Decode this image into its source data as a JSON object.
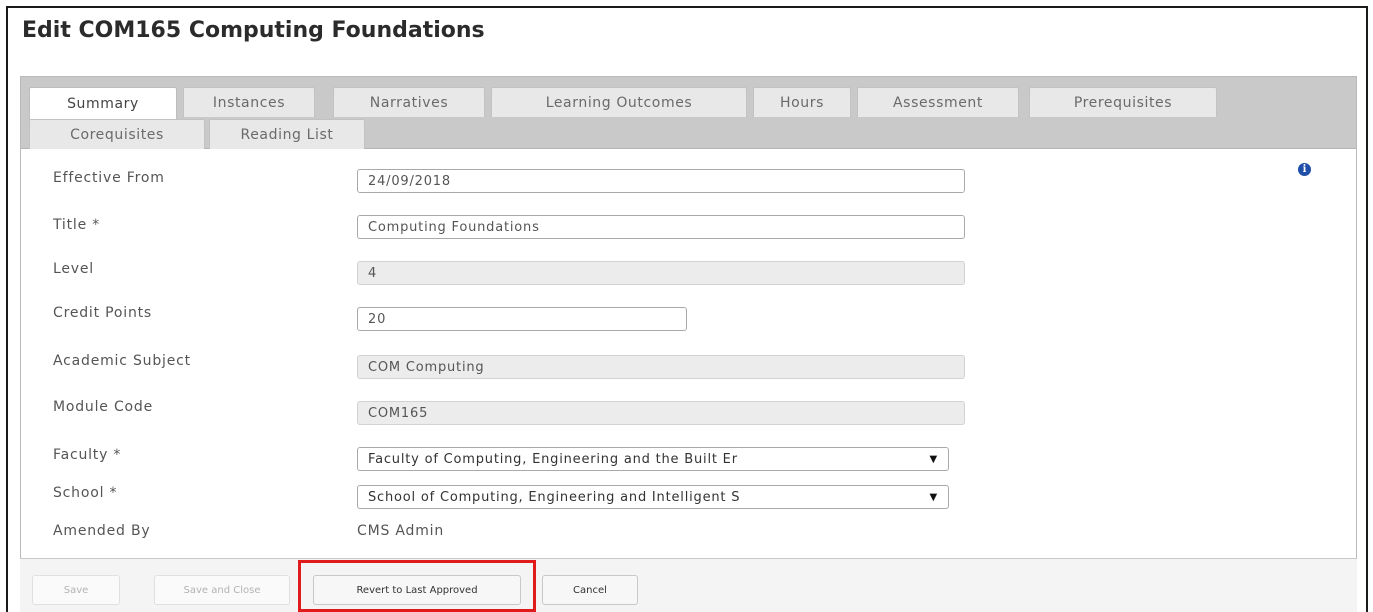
{
  "header": {
    "title": "Edit COM165 Computing Foundations"
  },
  "tabs": [
    {
      "label": "Summary",
      "active": true
    },
    {
      "label": "Instances"
    },
    {
      "label": "Narratives"
    },
    {
      "label": "Learning Outcomes"
    },
    {
      "label": "Hours"
    },
    {
      "label": "Assessment"
    },
    {
      "label": "Prerequisites"
    },
    {
      "label": "Corequisites"
    },
    {
      "label": "Reading List"
    }
  ],
  "form": {
    "effective_from": {
      "label": "Effective From",
      "value": "24/09/2018"
    },
    "title": {
      "label": "Title *",
      "value": "Computing Foundations"
    },
    "level": {
      "label": "Level",
      "value": "4"
    },
    "credit_points": {
      "label": "Credit Points",
      "value": "20"
    },
    "academic_subject": {
      "label": "Academic Subject",
      "value": "COM Computing"
    },
    "module_code": {
      "label": "Module Code",
      "value": "COM165"
    },
    "faculty": {
      "label": "Faculty *",
      "value": "Faculty of Computing, Engineering and the Built Er"
    },
    "school": {
      "label": "School *",
      "value": "School of Computing, Engineering and Intelligent S"
    },
    "amended_by": {
      "label": "Amended By",
      "value": "CMS Admin"
    }
  },
  "icons": {
    "info": "info-icon",
    "dropdown": "caret-down-icon"
  },
  "footer": {
    "save": "Save",
    "save_close": "Save and Close",
    "revert": "Revert to Last Approved",
    "cancel": "Cancel"
  },
  "colors": {
    "highlight": "#e11b1b",
    "info": "#1f4fa8"
  }
}
